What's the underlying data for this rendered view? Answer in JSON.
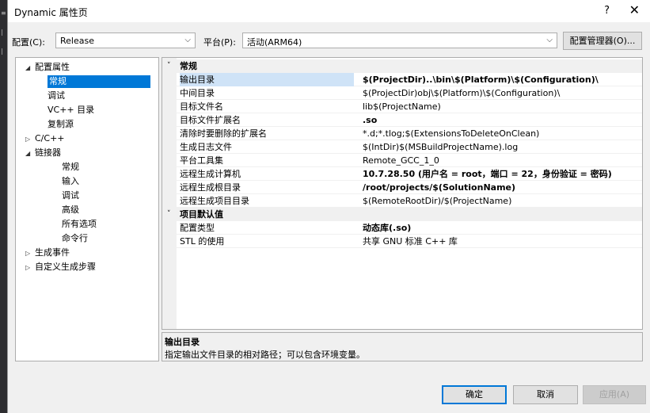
{
  "window": {
    "title": "Dynamic 属性页",
    "help_label": "?",
    "close_label": "✕"
  },
  "toolbar": {
    "config_label": "配置(C):",
    "config_value": "Release",
    "platform_label": "平台(P):",
    "platform_value": "活动(ARM64)",
    "config_manager_label": "配置管理器(O)..."
  },
  "tree": {
    "items": [
      {
        "label": "配置属性",
        "expander": "◢",
        "selected": false
      },
      {
        "label": "常规",
        "expander": "",
        "selected": true
      },
      {
        "label": "调试",
        "expander": "",
        "selected": false
      },
      {
        "label": "VC++ 目录",
        "expander": "",
        "selected": false
      },
      {
        "label": "复制源",
        "expander": "",
        "selected": false
      },
      {
        "label": "C/C++",
        "expander": "▷",
        "selected": false
      },
      {
        "label": "链接器",
        "expander": "◢",
        "selected": false
      },
      {
        "label": "常规",
        "expander": "",
        "selected": false
      },
      {
        "label": "输入",
        "expander": "",
        "selected": false
      },
      {
        "label": "调试",
        "expander": "",
        "selected": false
      },
      {
        "label": "高级",
        "expander": "",
        "selected": false
      },
      {
        "label": "所有选项",
        "expander": "",
        "selected": false
      },
      {
        "label": "命令行",
        "expander": "",
        "selected": false
      },
      {
        "label": "生成事件",
        "expander": "▷",
        "selected": false
      },
      {
        "label": "自定义生成步骤",
        "expander": "▷",
        "selected": false
      }
    ]
  },
  "grid": {
    "categories": [
      {
        "label": "常规",
        "chevron": "˅",
        "rows": [
          {
            "name": "输出目录",
            "value": "$(ProjectDir)..\\bin\\$(Platform)\\$(Configuration)\\",
            "bold": true,
            "selected": true
          },
          {
            "name": "中间目录",
            "value": "$(ProjectDir)obj\\$(Platform)\\$(Configuration)\\",
            "bold": false,
            "selected": false
          },
          {
            "name": "目标文件名",
            "value": "lib$(ProjectName)",
            "bold": false,
            "selected": false
          },
          {
            "name": "目标文件扩展名",
            "value": ".so",
            "bold": true,
            "selected": false
          },
          {
            "name": "清除时要删除的扩展名",
            "value": "*.d;*.tlog;$(ExtensionsToDeleteOnClean)",
            "bold": false,
            "selected": false
          },
          {
            "name": "生成日志文件",
            "value": "$(IntDir)$(MSBuildProjectName).log",
            "bold": false,
            "selected": false
          },
          {
            "name": "平台工具集",
            "value": "Remote_GCC_1_0",
            "bold": false,
            "selected": false
          },
          {
            "name": "远程生成计算机",
            "value": "10.7.28.50 (用户名 = root，端口 = 22，身份验证 = 密码)",
            "bold": true,
            "selected": false
          },
          {
            "name": "远程生成根目录",
            "value": "/root/projects/$(SolutionName)",
            "bold": true,
            "selected": false
          },
          {
            "name": "远程生成项目目录",
            "value": "$(RemoteRootDir)/$(ProjectName)",
            "bold": false,
            "selected": false
          }
        ]
      },
      {
        "label": "项目默认值",
        "chevron": "˅",
        "rows": [
          {
            "name": "配置类型",
            "value": "动态库(.so)",
            "bold": true,
            "selected": false
          },
          {
            "name": "STL 的使用",
            "value": "共享 GNU 标准 C++ 库",
            "bold": false,
            "selected": false
          }
        ]
      }
    ]
  },
  "description": {
    "title": "输出目录",
    "text": "指定输出文件目录的相对路径；可以包含环境变量。"
  },
  "buttons": {
    "ok": "确定",
    "cancel": "取消",
    "apply": "应用(A)"
  },
  "colors": {
    "accent": "#0078d7",
    "selection_light": "#cfe3f7"
  }
}
